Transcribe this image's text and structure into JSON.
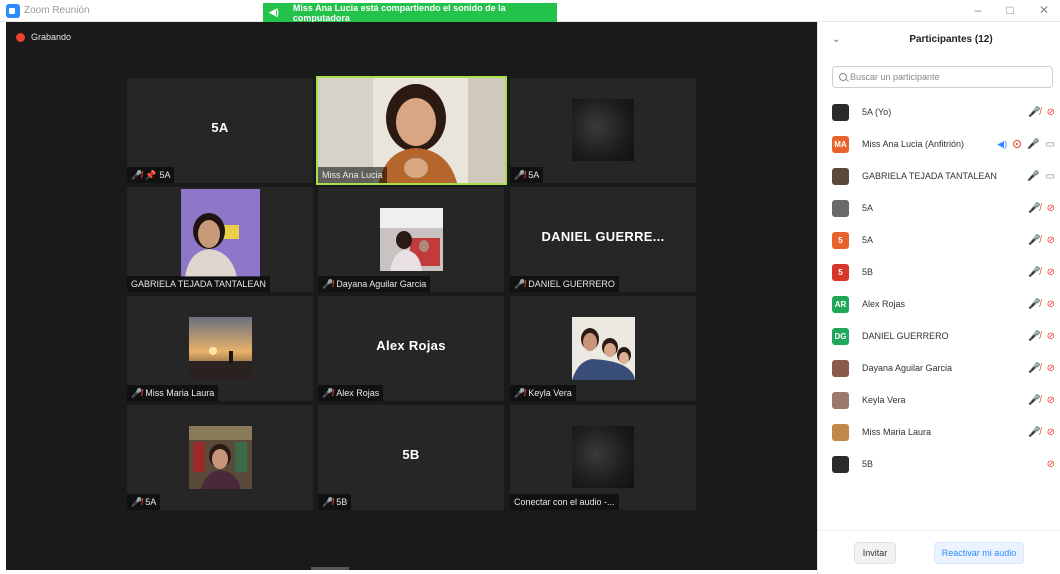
{
  "window": {
    "title": "Zoom Reunión",
    "controls": [
      "–",
      "□",
      "✕"
    ]
  },
  "share_banner": {
    "text": "Miss Ana Lucia está compartiendo el sonido de la computadora"
  },
  "meeting": {
    "recording_label": "Grabando",
    "tiles": [
      {
        "big_name": "5A",
        "label": "5A",
        "muted": true,
        "pinned": true
      },
      {
        "big_name": "",
        "label": "Miss Ana Lucia",
        "muted": false,
        "pinned": false,
        "speaking": true
      },
      {
        "big_name": "",
        "label": "5A",
        "muted": true,
        "pinned": false
      },
      {
        "big_name": "",
        "label": "GABRIELA TEJADA TANTALEAN",
        "muted": false,
        "pinned": false
      },
      {
        "big_name": "",
        "label": "Dayana Aguilar Garcia",
        "muted": true,
        "pinned": false
      },
      {
        "big_name": "DANIEL GUERRE...",
        "label": "DANIEL GUERRERO",
        "muted": true,
        "pinned": false
      },
      {
        "big_name": "",
        "label": "Miss Maria Laura",
        "muted": true,
        "pinned": false
      },
      {
        "big_name": "Alex Rojas",
        "label": "Alex Rojas",
        "muted": true,
        "pinned": false
      },
      {
        "big_name": "",
        "label": "Keyla Vera",
        "muted": true,
        "pinned": false
      },
      {
        "big_name": "",
        "label": "5A",
        "muted": true,
        "pinned": false
      },
      {
        "big_name": "5B",
        "label": "5B",
        "muted": true,
        "pinned": false
      },
      {
        "big_name": "",
        "label": "Conectar con el audio -...",
        "muted": false,
        "pinned": false
      }
    ]
  },
  "panel": {
    "title": "Participantes (12)",
    "search_placeholder": "Buscar un participante",
    "participants": [
      {
        "initials": "",
        "name": "5A (Yo)",
        "avatar_color": "#2a2a2a"
      },
      {
        "initials": "MA",
        "name": "Miss Ana Lucia (Anfitrión)",
        "avatar_color": "#e8632b"
      },
      {
        "initials": "",
        "name": "GABRIELA TEJADA TANTALEAN",
        "avatar_color": "#5a4a3a"
      },
      {
        "initials": "",
        "name": "5A",
        "avatar_color": "#6a6a6a"
      },
      {
        "initials": "5",
        "name": "5A",
        "avatar_color": "#e8632b"
      },
      {
        "initials": "5",
        "name": "5B",
        "avatar_color": "#d8362b"
      },
      {
        "initials": "AR",
        "name": "Alex Rojas",
        "avatar_color": "#1fa85a"
      },
      {
        "initials": "DG",
        "name": "DANIEL GUERRERO",
        "avatar_color": "#1fa85a"
      },
      {
        "initials": "",
        "name": "Dayana Aguilar Garcia",
        "avatar_color": "#8a5a4a"
      },
      {
        "initials": "",
        "name": "Keyla Vera",
        "avatar_color": "#9a7a6a"
      },
      {
        "initials": "",
        "name": "Miss Maria Laura",
        "avatar_color": "#c08a4a"
      },
      {
        "initials": "",
        "name": "5B",
        "avatar_color": "#2a2a2a"
      }
    ],
    "invite_label": "Invitar",
    "unmute_label": "Reactivar mi audio"
  }
}
